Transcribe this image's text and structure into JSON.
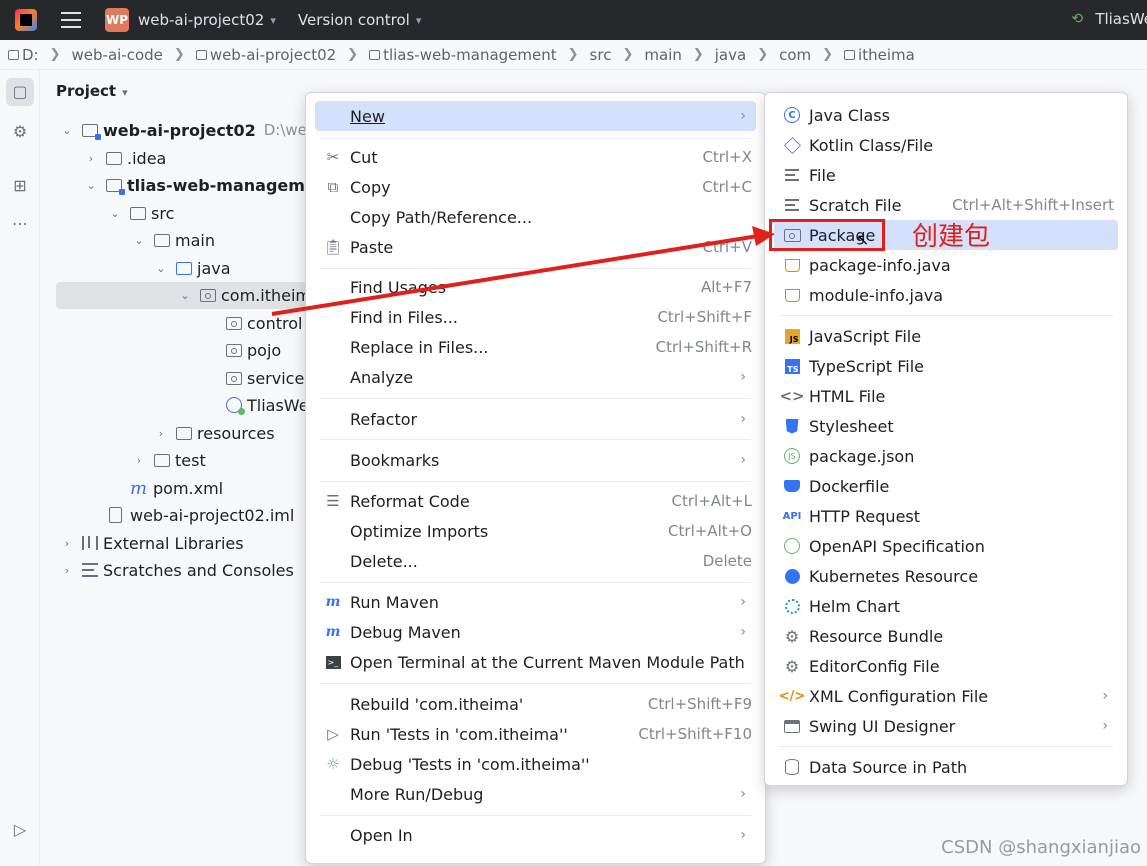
{
  "titlebar": {
    "project_badge": "WP",
    "project_name": "web-ai-project02",
    "vcs": "Version control",
    "run_config": "TliasWe"
  },
  "breadcrumb": [
    "D:",
    "web-ai-code",
    "web-ai-project02",
    "tlias-web-management",
    "src",
    "main",
    "java",
    "com",
    "itheima"
  ],
  "panel": {
    "title": "Project",
    "tree": [
      {
        "label": "web-ai-project02",
        "extra": "D:\\web"
      },
      {
        "label": ".idea"
      },
      {
        "label": "tlias-web-manageme"
      },
      {
        "label": "src"
      },
      {
        "label": "main"
      },
      {
        "label": "java"
      },
      {
        "label": "com.itheim"
      },
      {
        "label": "control"
      },
      {
        "label": "pojo"
      },
      {
        "label": "service"
      },
      {
        "label": "TliasWe"
      },
      {
        "label": "resources"
      },
      {
        "label": "test"
      },
      {
        "label": "pom.xml"
      },
      {
        "label": "web-ai-project02.iml"
      },
      {
        "label": "External Libraries"
      },
      {
        "label": "Scratches and Consoles"
      }
    ]
  },
  "context_menu": {
    "items": [
      {
        "label": "New",
        "shortcut": ""
      },
      {
        "label": "Cut",
        "shortcut": "Ctrl+X"
      },
      {
        "label": "Copy",
        "shortcut": "Ctrl+C"
      },
      {
        "label": "Copy Path/Reference...",
        "shortcut": ""
      },
      {
        "label": "Paste",
        "shortcut": "Ctrl+V"
      },
      {
        "label": "Find Usages",
        "shortcut": "Alt+F7"
      },
      {
        "label": "Find in Files...",
        "shortcut": "Ctrl+Shift+F"
      },
      {
        "label": "Replace in Files...",
        "shortcut": "Ctrl+Shift+R"
      },
      {
        "label": "Analyze",
        "shortcut": ""
      },
      {
        "label": "Refactor",
        "shortcut": ""
      },
      {
        "label": "Bookmarks",
        "shortcut": ""
      },
      {
        "label": "Reformat Code",
        "shortcut": "Ctrl+Alt+L"
      },
      {
        "label": "Optimize Imports",
        "shortcut": "Ctrl+Alt+O"
      },
      {
        "label": "Delete...",
        "shortcut": "Delete"
      },
      {
        "label": "Run Maven",
        "shortcut": ""
      },
      {
        "label": "Debug Maven",
        "shortcut": ""
      },
      {
        "label": "Open Terminal at the Current Maven Module Path",
        "shortcut": ""
      },
      {
        "label": "Rebuild 'com.itheima'",
        "shortcut": "Ctrl+Shift+F9"
      },
      {
        "label": "Run 'Tests in 'com.itheima''",
        "shortcut": "Ctrl+Shift+F10"
      },
      {
        "label": "Debug 'Tests in 'com.itheima''",
        "shortcut": ""
      },
      {
        "label": "More Run/Debug",
        "shortcut": ""
      },
      {
        "label": "Open In",
        "shortcut": ""
      }
    ]
  },
  "new_submenu": {
    "items": [
      {
        "label": "Java Class",
        "shortcut": ""
      },
      {
        "label": "Kotlin Class/File",
        "shortcut": ""
      },
      {
        "label": "File",
        "shortcut": ""
      },
      {
        "label": "Scratch File",
        "shortcut": "Ctrl+Alt+Shift+Insert"
      },
      {
        "label": "Package",
        "shortcut": ""
      },
      {
        "label": "package-info.java",
        "shortcut": ""
      },
      {
        "label": "module-info.java",
        "shortcut": ""
      },
      {
        "label": "JavaScript File",
        "shortcut": ""
      },
      {
        "label": "TypeScript File",
        "shortcut": ""
      },
      {
        "label": "HTML File",
        "shortcut": ""
      },
      {
        "label": "Stylesheet",
        "shortcut": ""
      },
      {
        "label": "package.json",
        "shortcut": ""
      },
      {
        "label": "Dockerfile",
        "shortcut": ""
      },
      {
        "label": "HTTP Request",
        "shortcut": ""
      },
      {
        "label": "OpenAPI Specification",
        "shortcut": ""
      },
      {
        "label": "Kubernetes Resource",
        "shortcut": ""
      },
      {
        "label": "Helm Chart",
        "shortcut": ""
      },
      {
        "label": "Resource Bundle",
        "shortcut": ""
      },
      {
        "label": "EditorConfig File",
        "shortcut": ""
      },
      {
        "label": "XML Configuration File",
        "shortcut": ""
      },
      {
        "label": "Swing UI Designer",
        "shortcut": ""
      },
      {
        "label": "Data Source in Path",
        "shortcut": ""
      }
    ]
  },
  "annotation": {
    "text": "创建包"
  },
  "watermark": "CSDN @shangxianjiao",
  "colors": {
    "highlight": "#d5e1fc",
    "annotation": "#e0201a",
    "titlebar": "#27282c"
  }
}
